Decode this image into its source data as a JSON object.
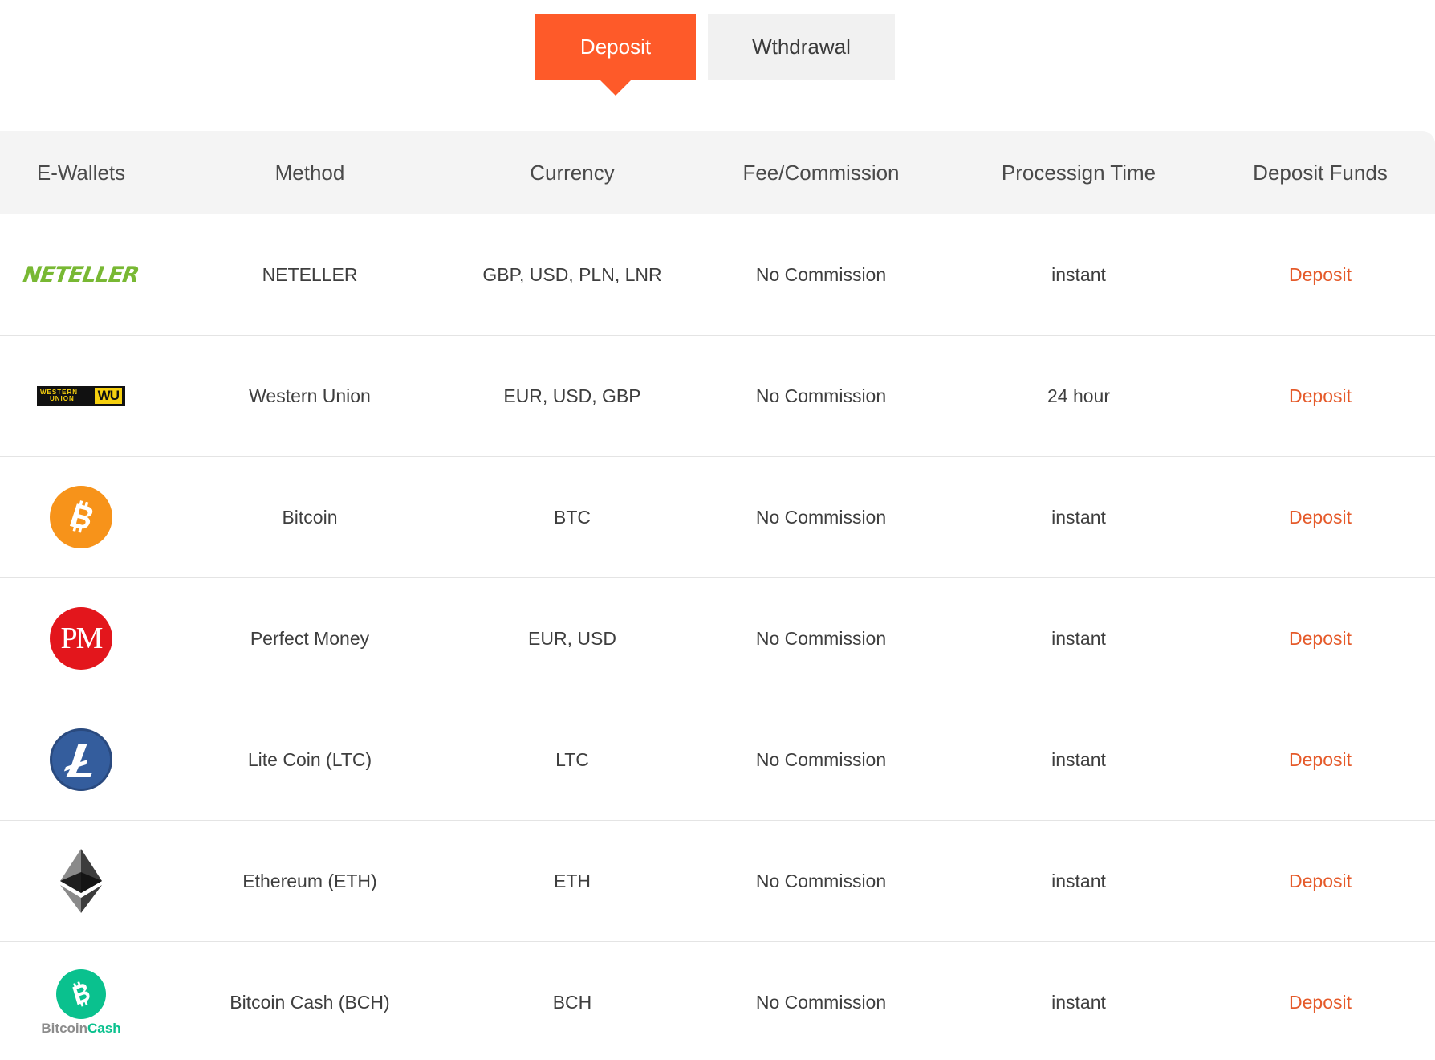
{
  "tabs": {
    "deposit_label": "Deposit",
    "withdrawal_label": "Wthdrawal",
    "active": "Deposit"
  },
  "table": {
    "headers": [
      "E-Wallets",
      "Method",
      "Currency",
      "Fee/Commission",
      "Processign Time",
      "Deposit Funds"
    ],
    "rows": [
      {
        "logo": "NETELLER",
        "method": "NETELLER",
        "currency": "GBP, USD, PLN, LNR",
        "fee": "No Commission",
        "time": "instant",
        "action": "Deposit"
      },
      {
        "logo": "WESTERN UNION WU",
        "method": "Western Union",
        "currency": "EUR, USD, GBP",
        "fee": "No Commission",
        "time": "24 hour",
        "action": "Deposit"
      },
      {
        "logo": "bitcoin-icon",
        "method": "Bitcoin",
        "currency": "BTC",
        "fee": "No Commission",
        "time": "instant",
        "action": "Deposit"
      },
      {
        "logo": "PM",
        "method": "Perfect Money",
        "currency": "EUR, USD",
        "fee": "No Commission",
        "time": "instant",
        "action": "Deposit"
      },
      {
        "logo": "litecoin-icon",
        "method": "Lite Coin (LTC)",
        "currency": "LTC",
        "fee": "No Commission",
        "time": "instant",
        "action": "Deposit"
      },
      {
        "logo": "ethereum-icon",
        "method": "Ethereum (ETH)",
        "currency": "ETH",
        "fee": "No Commission",
        "time": "instant",
        "action": "Deposit"
      },
      {
        "logo": "BitcoinCash",
        "method": "Bitcoin Cash (BCH)",
        "currency": "BCH",
        "fee": "No Commission",
        "time": "instant",
        "action": "Deposit"
      }
    ]
  },
  "colors": {
    "accent": "#fe5a29",
    "link": "#e55a2a",
    "header_bg": "#f4f4f4"
  },
  "logo_text": {
    "neteller": "NETELLER",
    "wu_line1": "WESTERN",
    "wu_line2": "UNION",
    "wu_box": "WU",
    "pm": "PM",
    "bch_a": "Bitcoin",
    "bch_b": "Cash"
  }
}
